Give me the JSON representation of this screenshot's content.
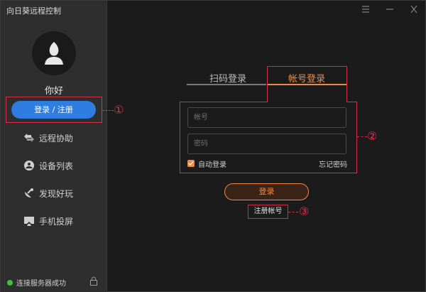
{
  "app": {
    "title": "向日葵远程控制"
  },
  "sidebar": {
    "greeting": "你好",
    "login_button": "登录 / 注册",
    "items": [
      {
        "label": "远程协助",
        "icon": "remote-assist-icon"
      },
      {
        "label": "设备列表",
        "icon": "device-list-icon"
      },
      {
        "label": "发现好玩",
        "icon": "satellite-icon"
      },
      {
        "label": "手机投屏",
        "icon": "screen-cast-icon"
      }
    ],
    "status": "连接服务器成功"
  },
  "tabs": [
    {
      "label": "扫码登录",
      "active": false
    },
    {
      "label": "帐号登录",
      "active": true
    }
  ],
  "form": {
    "account_placeholder": "帐号",
    "password_placeholder": "密码",
    "auto_login": "自动登录",
    "auto_login_checked": true,
    "forgot": "忘记密码",
    "submit": "登录",
    "register": "注册帐号"
  },
  "callouts": {
    "one": "①",
    "two": "②",
    "three": "③"
  },
  "colors": {
    "accent": "#ee8a45",
    "primary": "#2f7de1",
    "annotation": "#d0304a",
    "online": "#3cc23c"
  }
}
